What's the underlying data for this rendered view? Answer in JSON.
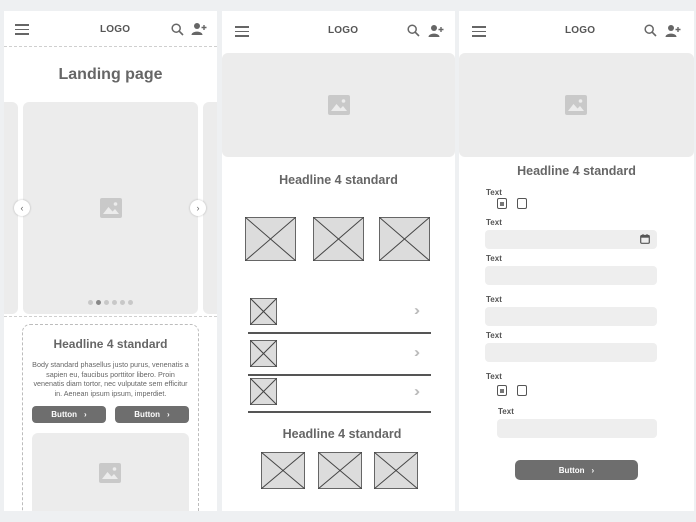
{
  "header": {
    "logo": "LOGO"
  },
  "screen1": {
    "title": "Landing page",
    "card_headline": "Headline 4 standard",
    "card_body": "Body standard phasellus justo purus, venenatis a sapien eu, faucibus porttitor libero. Proin venenatis diam tortor, nec vulputate sem efficitur in. Aenean ipsum ipsum, imperdiet.",
    "button_left": "Button",
    "button_right": "Button",
    "carousel": {
      "dots": 6,
      "active": 2
    }
  },
  "screen2": {
    "headline1": "Headline 4 standard",
    "headline2": "Headline 4 standard"
  },
  "screen3": {
    "headline": "Headline 4 standard",
    "labels": [
      "Text",
      "Text",
      "Text",
      "Text",
      "Text",
      "Text",
      "Text"
    ],
    "button": "Button"
  },
  "colors": {
    "background": "#eef0f2",
    "placeholder": "#ececec",
    "button": "#6e6e6e"
  }
}
